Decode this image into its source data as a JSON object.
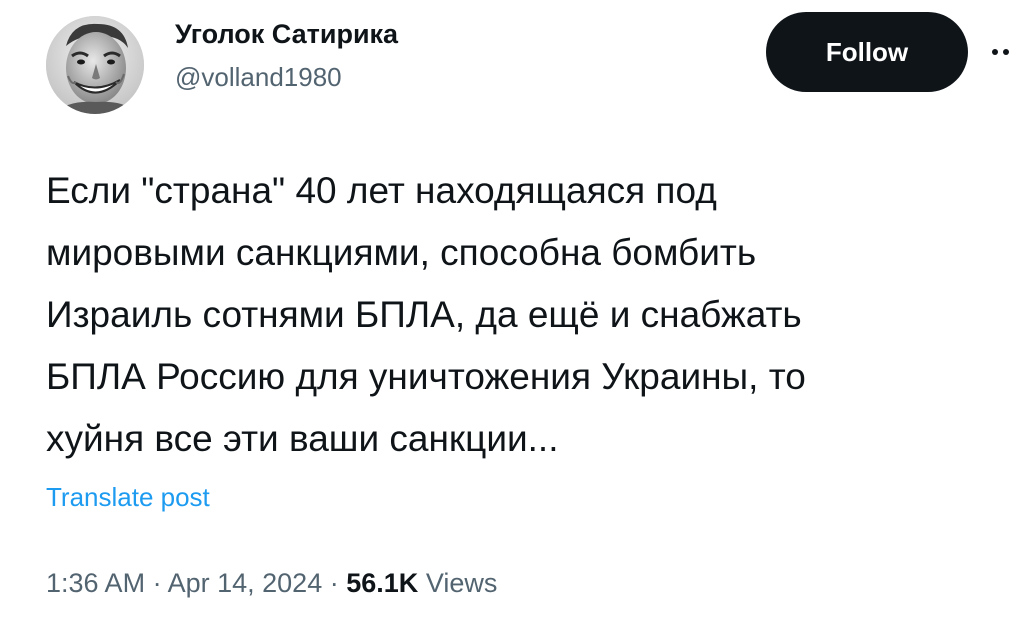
{
  "author": {
    "display_name": "Уголок Сатирика",
    "handle": "@volland1980",
    "avatar_icon": "smiling-man-avatar"
  },
  "actions": {
    "follow_label": "Follow",
    "more_icon": "more-horizontal-icon"
  },
  "post": {
    "lines": [
      "Если \"страна\" 40 лет находящаяся под",
      "мировыми санкциями, способна бомбить",
      "Израиль сотнями БПЛА, да ещё и снабжать",
      "БПЛА Россию для уничтожения Украины, то",
      "хуйня все эти ваши санкции..."
    ],
    "translate_label": "Translate post"
  },
  "meta": {
    "time": "1:36 AM",
    "separator": "·",
    "date": "Apr 14, 2024",
    "views_count": "56.1K",
    "views_label": "Views"
  },
  "colors": {
    "text": "#0f1419",
    "secondary": "#536471",
    "link": "#1d9bf0",
    "button_bg": "#0f1419"
  }
}
